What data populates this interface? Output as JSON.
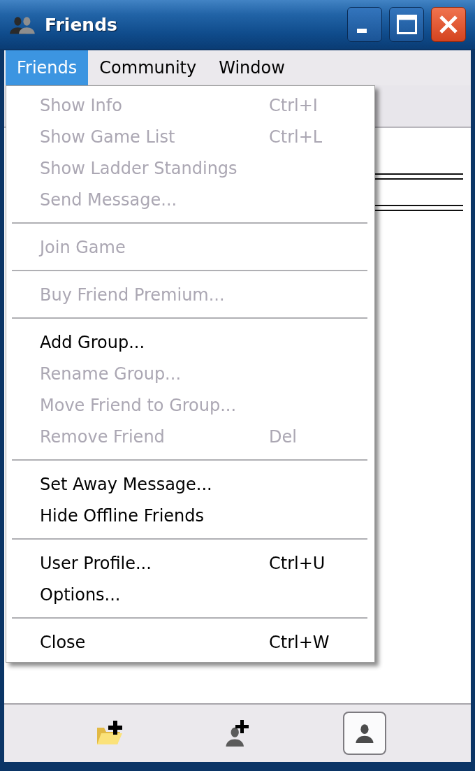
{
  "window": {
    "title": "Friends"
  },
  "menubar": [
    {
      "label": "Friends",
      "selected": true
    },
    {
      "label": "Community",
      "selected": false
    },
    {
      "label": "Window",
      "selected": false
    }
  ],
  "menu": {
    "groups": [
      {
        "items": [
          {
            "label": "Show Info",
            "shortcut": "Ctrl+I",
            "disabled": true
          },
          {
            "label": "Show Game List",
            "shortcut": "Ctrl+L",
            "disabled": true
          },
          {
            "label": "Show Ladder Standings",
            "disabled": true
          },
          {
            "label": "Send Message...",
            "disabled": true
          }
        ]
      },
      {
        "items": [
          {
            "label": "Join Game",
            "disabled": true
          }
        ]
      },
      {
        "items": [
          {
            "label": "Buy Friend Premium...",
            "disabled": true
          }
        ]
      },
      {
        "items": [
          {
            "label": "Add Group...",
            "disabled": false
          },
          {
            "label": "Rename Group...",
            "disabled": true
          },
          {
            "label": "Move Friend to Group...",
            "disabled": true
          },
          {
            "label": "Remove Friend",
            "shortcut": "Del",
            "disabled": true
          }
        ]
      },
      {
        "items": [
          {
            "label": "Set Away Message...",
            "disabled": false
          },
          {
            "label": "Hide Offline Friends",
            "disabled": false
          }
        ]
      },
      {
        "items": [
          {
            "label": "User Profile...",
            "shortcut": "Ctrl+U",
            "disabled": false
          },
          {
            "label": "Options...",
            "disabled": false
          }
        ]
      },
      {
        "items": [
          {
            "label": "Close",
            "shortcut": "Ctrl+W",
            "disabled": false
          }
        ]
      }
    ]
  },
  "toolbar": {
    "buttons": [
      {
        "kind": "folder",
        "selected": false
      },
      {
        "kind": "user-add",
        "selected": false
      },
      {
        "kind": "user",
        "selected": true
      }
    ]
  }
}
